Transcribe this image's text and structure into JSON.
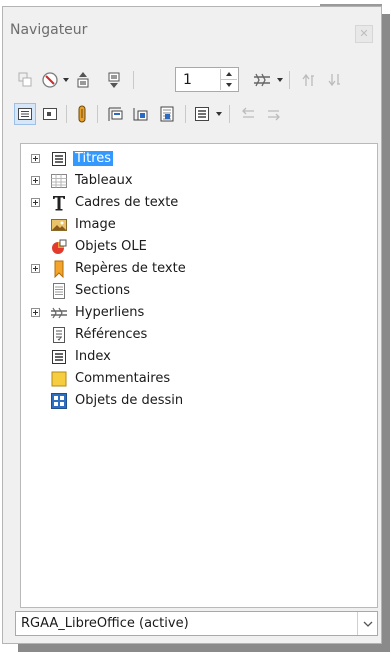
{
  "window": {
    "title": "Navigateur",
    "close_glyph": "✕"
  },
  "toolbar_row1": {
    "icons": [
      "toggle-icon",
      "navigation-icon",
      "previous-icon",
      "next-icon",
      "hyperlink-mode-icon",
      "promote-icon",
      "demote-icon"
    ],
    "page_number": "1"
  },
  "toolbar_row2": {
    "icons": [
      "content-view-icon",
      "header-icon",
      "anchor-icon",
      "footer-icon",
      "set-reminder-icon",
      "headings-level-icon",
      "heading-levels-dropdown-icon",
      "move-up-icon",
      "move-down-icon"
    ]
  },
  "tree": {
    "items": [
      {
        "label": "Titres",
        "icon": "headings-icon",
        "expandable": true,
        "selected": true
      },
      {
        "label": "Tableaux",
        "icon": "table-icon",
        "expandable": true,
        "selected": false
      },
      {
        "label": "Cadres de texte",
        "icon": "text-frame-icon",
        "expandable": true,
        "selected": false
      },
      {
        "label": "Image",
        "icon": "image-icon",
        "expandable": false,
        "selected": false
      },
      {
        "label": "Objets OLE",
        "icon": "ole-object-icon",
        "expandable": false,
        "selected": false
      },
      {
        "label": "Repères de texte",
        "icon": "bookmark-icon",
        "expandable": true,
        "selected": false
      },
      {
        "label": "Sections",
        "icon": "section-icon",
        "expandable": false,
        "selected": false
      },
      {
        "label": "Hyperliens",
        "icon": "hyperlink-icon",
        "expandable": true,
        "selected": false
      },
      {
        "label": "Références",
        "icon": "reference-icon",
        "expandable": false,
        "selected": false
      },
      {
        "label": "Index",
        "icon": "index-icon",
        "expandable": false,
        "selected": false
      },
      {
        "label": "Commentaires",
        "icon": "comment-icon",
        "expandable": false,
        "selected": false
      },
      {
        "label": "Objets de dessin",
        "icon": "drawing-object-icon",
        "expandable": false,
        "selected": false
      }
    ]
  },
  "document_select": {
    "value": "RGAA_LibreOffice (active)"
  },
  "colors": {
    "selection": "#3399ff",
    "panel": "#f0f0f0",
    "accent_blue": "#1f5fb5"
  }
}
